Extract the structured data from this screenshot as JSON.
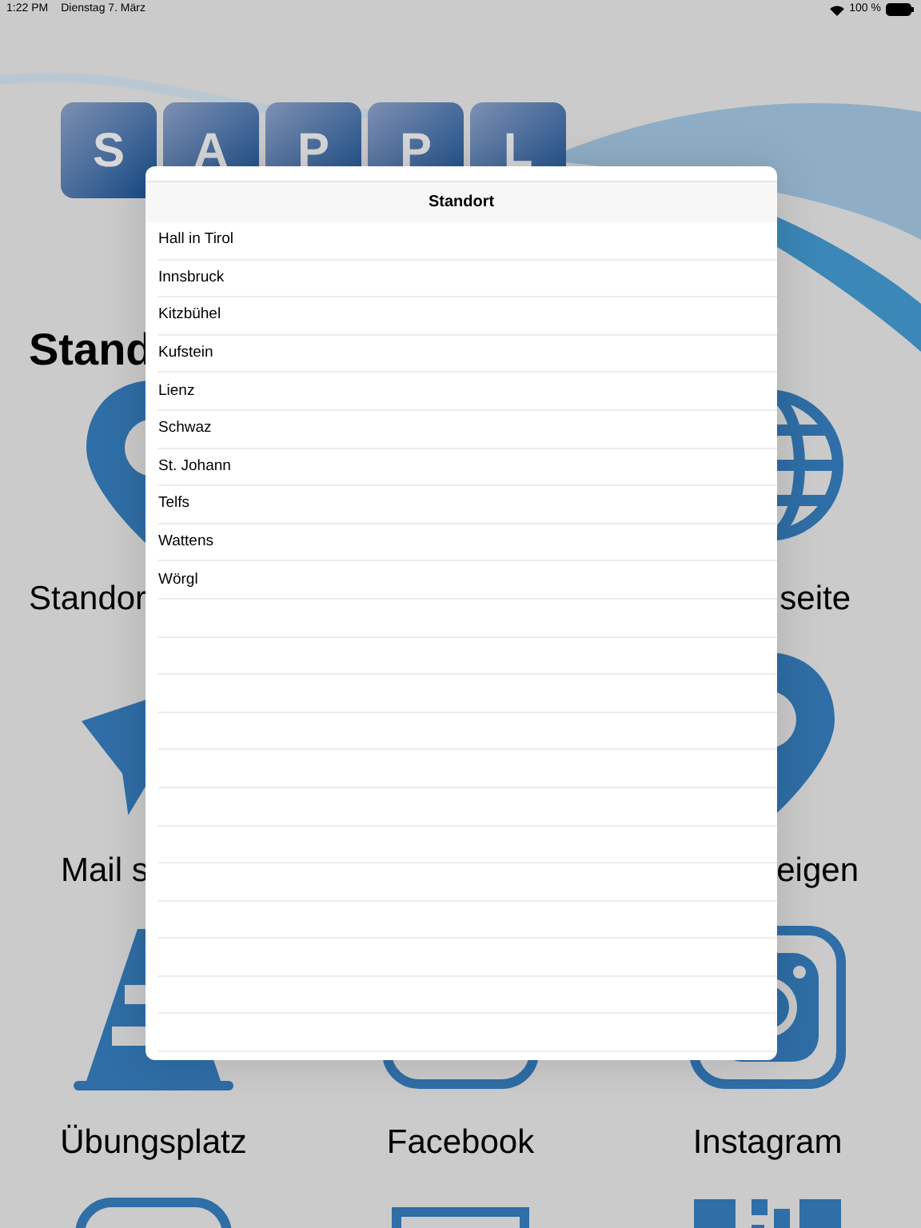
{
  "status_bar": {
    "time": "1:22 PM",
    "date": "Dienstag 7. März",
    "battery": "100 %"
  },
  "logo_letters": [
    "S",
    "A",
    "P",
    "P",
    "L"
  ],
  "page_title": "Stand",
  "grid": [
    {
      "kind": "pin",
      "label": "Standor"
    },
    {
      "kind": "none"
    },
    {
      "kind": "globe",
      "label": "seite"
    },
    {
      "kind": "plane",
      "label": "Mail s"
    },
    {
      "kind": "none"
    },
    {
      "kind": "pin",
      "label": "eigen"
    },
    {
      "kind": "cone",
      "label": "Übungsplatz"
    },
    {
      "kind": "facebook",
      "label": "Facebook"
    },
    {
      "kind": "instagram",
      "label": "Instagram"
    },
    {
      "kind": "frame"
    },
    {
      "kind": "screen"
    },
    {
      "kind": "qr"
    }
  ],
  "popover": {
    "title": "Standort",
    "items": [
      "Hall in Tirol",
      "Innsbruck",
      "Kitzbühel",
      "Kufstein",
      "Lienz",
      "Schwaz",
      "St. Johann",
      "Telfs",
      "Wattens",
      "Wörgl"
    ]
  }
}
